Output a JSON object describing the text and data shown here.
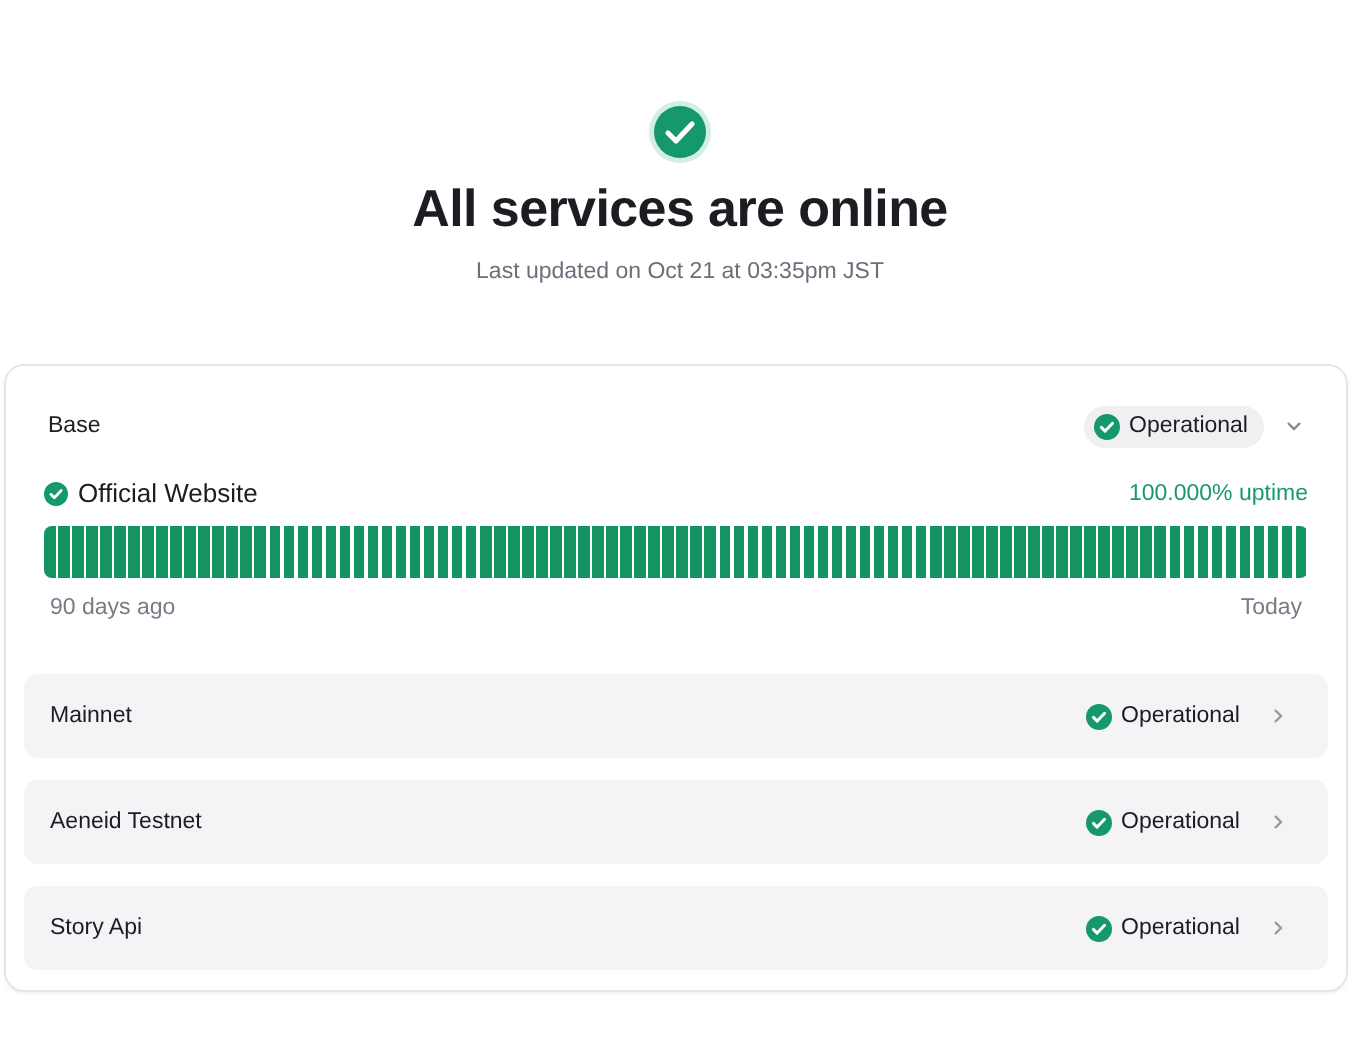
{
  "header": {
    "title": "All services are online",
    "updated": "Last updated on Oct 21 at 03:35pm JST"
  },
  "group": {
    "name": "Base",
    "status": "Operational",
    "expanded": true,
    "service": {
      "name": "Official Website",
      "uptime": "100.000% uptime",
      "start_label": "90 days ago",
      "end_label": "Today",
      "days_up": [
        true,
        true,
        true,
        true,
        true,
        true,
        true,
        true,
        true,
        true,
        true,
        true,
        true,
        true,
        true,
        true,
        true,
        true,
        true,
        true,
        true,
        true,
        true,
        true,
        true,
        true,
        true,
        true,
        true,
        true,
        true,
        true,
        true,
        true,
        true,
        true,
        true,
        true,
        true,
        true,
        true,
        true,
        true,
        true,
        true,
        true,
        true,
        true,
        true,
        true,
        true,
        true,
        true,
        true,
        true,
        true,
        true,
        true,
        true,
        true,
        true,
        true,
        true,
        true,
        true,
        true,
        true,
        true,
        true,
        true,
        true,
        true,
        true,
        true,
        true,
        true,
        true,
        true,
        true,
        true,
        true,
        true,
        true,
        true,
        true,
        true,
        true,
        true,
        true,
        true
      ]
    }
  },
  "components": [
    {
      "name": "Mainnet",
      "status": "Operational"
    },
    {
      "name": "Aeneid Testnet",
      "status": "Operational"
    },
    {
      "name": "Story Api",
      "status": "Operational"
    }
  ]
}
